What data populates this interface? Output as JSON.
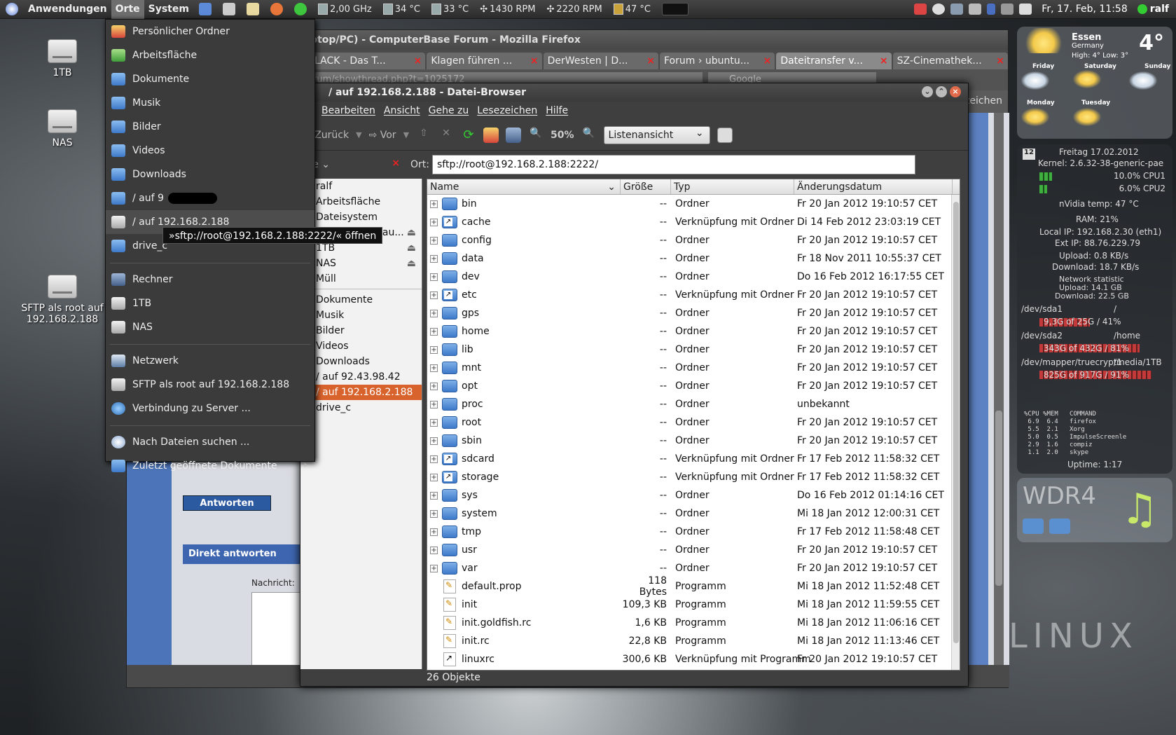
{
  "panel": {
    "menus": [
      "Anwendungen",
      "Orte",
      "System"
    ],
    "sensors": {
      "cpu_freq": "2,00 GHz",
      "temp1": "34 °C",
      "temp2": "33 °C",
      "fan1": "1430 RPM",
      "fan2": "2220 RPM",
      "temp3": "47 °C"
    },
    "clock": "Fr, 17. Feb, 11:58",
    "user": "ralf"
  },
  "desktop_icons": [
    {
      "label": "1TB"
    },
    {
      "label": "NAS"
    },
    {
      "label": "SFTP als root auf 192.168.2.188"
    }
  ],
  "places_menu": {
    "items": [
      {
        "label": "Persönlicher Ordner",
        "icon": "home-icon"
      },
      {
        "label": "Arbeitsfläche",
        "icon": "desktop-icon"
      },
      {
        "label": "Dokumente",
        "icon": "folder-icon"
      },
      {
        "label": "Musik",
        "icon": "folder-icon"
      },
      {
        "label": "Bilder",
        "icon": "folder-icon"
      },
      {
        "label": "Videos",
        "icon": "folder-icon"
      },
      {
        "label": "Downloads",
        "icon": "folder-icon"
      },
      {
        "label": "/ auf 9",
        "icon": "folder-icon"
      },
      {
        "label": "/ auf 192.168.2.188",
        "icon": "drive-icon"
      },
      {
        "label": "drive_c",
        "icon": "folder-icon"
      }
    ],
    "devices": [
      {
        "label": "Rechner",
        "icon": "computer-icon"
      },
      {
        "label": "1TB",
        "icon": "drive-icon"
      },
      {
        "label": "NAS",
        "icon": "drive-icon"
      }
    ],
    "network": [
      {
        "label": "Netzwerk",
        "icon": "network-icon"
      },
      {
        "label": "SFTP als root auf 192.168.2.188",
        "icon": "drive-icon"
      },
      {
        "label": "Verbindung zu Server ...",
        "icon": "globe-icon"
      }
    ],
    "extras": [
      {
        "label": "Nach Dateien suchen ...",
        "icon": "search-icon"
      },
      {
        "label": "Zuletzt geöffnete Dokumente",
        "icon": "folder-icon"
      }
    ],
    "tooltip": "»sftp://root@192.168.2.188:2222/« öffnen"
  },
  "firefox": {
    "title": "ptop/PC) - ComputerBase Forum - Mozilla Firefox",
    "tabs": [
      {
        "label": "LACK - Das T..."
      },
      {
        "label": "Klagen führen ..."
      },
      {
        "label": "DerWesten | D..."
      },
      {
        "label": "Forum › ubuntu..."
      },
      {
        "label": "Dateitransfer v...",
        "active": true
      },
      {
        "label": "SZ-Cinemathek..."
      }
    ],
    "url": "rum/showthread.php?t=1025172",
    "search_placeholder": "Google",
    "bookmarks_label": "ezeichen",
    "antworten": "Antworten",
    "direkt_antworten": "Direkt antworten",
    "nachricht": "Nachricht:"
  },
  "filebrowser": {
    "title": "/ auf 192.168.2.188 - Datei-Browser",
    "menu": [
      "tei",
      "Bearbeiten",
      "Ansicht",
      "Gehe zu",
      "Lesezeichen",
      "Hilfe"
    ],
    "toolbar": {
      "back": "Zurück",
      "forward": "Vor",
      "zoom": "50%",
      "view": "Listenansicht"
    },
    "side_title": "rte",
    "location_label": "Ort:",
    "location": "sftp://root@192.168.2.188:2222/",
    "sidebar": [
      {
        "label": "ralf"
      },
      {
        "label": "Arbeitsfläche"
      },
      {
        "label": "Dateisystem"
      },
      {
        "label": "SFTP als root au...",
        "eject": true
      },
      {
        "label": "1TB",
        "eject": true
      },
      {
        "label": "NAS",
        "eject": true
      },
      {
        "label": "Müll"
      },
      {
        "label": "Dokumente",
        "sep": true
      },
      {
        "label": "Musik"
      },
      {
        "label": "Bilder"
      },
      {
        "label": "Videos"
      },
      {
        "label": "Downloads"
      },
      {
        "label": "/ auf 92.43.98.42"
      },
      {
        "label": "/ auf 192.168.2.188",
        "selected": true
      },
      {
        "label": "drive_c"
      }
    ],
    "columns": [
      "Name",
      "Größe",
      "Typ",
      "Änderungsdatum"
    ],
    "rows": [
      {
        "name": "bin",
        "size": "--",
        "type": "Ordner",
        "date": "Fr 20 Jan 2012 19:10:57 CET",
        "kind": "folder"
      },
      {
        "name": "cache",
        "size": "--",
        "type": "Verknüpfung mit Ordner",
        "date": "Di 14 Feb 2012 23:03:19 CET",
        "kind": "folderlink"
      },
      {
        "name": "config",
        "size": "--",
        "type": "Ordner",
        "date": "Fr 20 Jan 2012 19:10:57 CET",
        "kind": "folder"
      },
      {
        "name": "data",
        "size": "--",
        "type": "Ordner",
        "date": "Fr 18 Nov 2011 10:55:37 CET",
        "kind": "folder"
      },
      {
        "name": "dev",
        "size": "--",
        "type": "Ordner",
        "date": "Do 16 Feb 2012 16:17:55 CET",
        "kind": "folder"
      },
      {
        "name": "etc",
        "size": "--",
        "type": "Verknüpfung mit Ordner",
        "date": "Fr 20 Jan 2012 19:10:57 CET",
        "kind": "folderlink"
      },
      {
        "name": "gps",
        "size": "--",
        "type": "Ordner",
        "date": "Fr 20 Jan 2012 19:10:57 CET",
        "kind": "folder"
      },
      {
        "name": "home",
        "size": "--",
        "type": "Ordner",
        "date": "Fr 20 Jan 2012 19:10:57 CET",
        "kind": "folder"
      },
      {
        "name": "lib",
        "size": "--",
        "type": "Ordner",
        "date": "Fr 20 Jan 2012 19:10:57 CET",
        "kind": "folder"
      },
      {
        "name": "mnt",
        "size": "--",
        "type": "Ordner",
        "date": "Fr 20 Jan 2012 19:10:57 CET",
        "kind": "folder"
      },
      {
        "name": "opt",
        "size": "--",
        "type": "Ordner",
        "date": "Fr 20 Jan 2012 19:10:57 CET",
        "kind": "folder"
      },
      {
        "name": "proc",
        "size": "--",
        "type": "Ordner",
        "date": "unbekannt",
        "kind": "folder"
      },
      {
        "name": "root",
        "size": "--",
        "type": "Ordner",
        "date": "Fr 20 Jan 2012 19:10:57 CET",
        "kind": "folder"
      },
      {
        "name": "sbin",
        "size": "--",
        "type": "Ordner",
        "date": "Fr 20 Jan 2012 19:10:57 CET",
        "kind": "folder"
      },
      {
        "name": "sdcard",
        "size": "--",
        "type": "Verknüpfung mit Ordner",
        "date": "Fr 17 Feb 2012 11:58:32 CET",
        "kind": "folderlink"
      },
      {
        "name": "storage",
        "size": "--",
        "type": "Verknüpfung mit Ordner",
        "date": "Fr 17 Feb 2012 11:58:32 CET",
        "kind": "folderlink"
      },
      {
        "name": "sys",
        "size": "--",
        "type": "Ordner",
        "date": "Do 16 Feb 2012 01:14:16 CET",
        "kind": "folder"
      },
      {
        "name": "system",
        "size": "--",
        "type": "Ordner",
        "date": "Mi 18 Jan 2012 12:00:31 CET",
        "kind": "folder"
      },
      {
        "name": "tmp",
        "size": "--",
        "type": "Ordner",
        "date": "Fr 17 Feb 2012 11:58:48 CET",
        "kind": "folder"
      },
      {
        "name": "usr",
        "size": "--",
        "type": "Ordner",
        "date": "Fr 20 Jan 2012 19:10:57 CET",
        "kind": "folder"
      },
      {
        "name": "var",
        "size": "--",
        "type": "Ordner",
        "date": "Fr 20 Jan 2012 19:10:57 CET",
        "kind": "folder"
      },
      {
        "name": "default.prop",
        "size": "118 Bytes",
        "type": "Programm",
        "date": "Mi 18 Jan 2012 11:52:48 CET",
        "kind": "file"
      },
      {
        "name": "init",
        "size": "109,3 KB",
        "type": "Programm",
        "date": "Mi 18 Jan 2012 11:59:55 CET",
        "kind": "file"
      },
      {
        "name": "init.goldfish.rc",
        "size": "1,6 KB",
        "type": "Programm",
        "date": "Mi 18 Jan 2012 11:06:16 CET",
        "kind": "file"
      },
      {
        "name": "init.rc",
        "size": "22,8 KB",
        "type": "Programm",
        "date": "Mi 18 Jan 2012 11:13:46 CET",
        "kind": "file"
      },
      {
        "name": "linuxrc",
        "size": "300,6 KB",
        "type": "Verknüpfung mit Programm",
        "date": "Fr 20 Jan 2012 19:10:57 CET",
        "kind": "filelink"
      }
    ],
    "status": "26 Objekte"
  },
  "weather": {
    "city": "Essen",
    "country": "Germany",
    "high_low": "High: 4°   Low: 3°",
    "temp": "4°",
    "days": [
      "Friday",
      "Saturday",
      "Sunday",
      "Monday",
      "Tuesday"
    ]
  },
  "conky": {
    "date": "Freitag 17.02.2012",
    "kernel": "Kernel: 2.6.32-38-generic-pae",
    "cpu1": "10.0% CPU1",
    "cpu1_level": 0.1,
    "cpu2": "6.0% CPU2",
    "cpu2_level": 0.06,
    "nvidia": "nVidia temp: 47 °C",
    "ram": "RAM: 21%",
    "local_ip": "Local IP: 192.168.2.30 (eth1)",
    "ext_ip": "Ext IP: 88.76.229.79",
    "upload": "Upload: 0.8 KB/s",
    "download": "Download: 18.7 KB/s",
    "netstat_title": "Network statistic",
    "net_up": "Upload: 14.1 GB",
    "net_down": "Download: 22.5 GB",
    "disks": [
      {
        "dev": "/dev/sda1",
        "mount": "/",
        "usage": "9,3G of 25G / 41%",
        "level": 0.41
      },
      {
        "dev": "/dev/sda2",
        "mount": "/home",
        "usage": "343G of 432G / 81%",
        "level": 0.81
      },
      {
        "dev": "/dev/mapper/truecrypt1",
        "mount": "/media/1TB",
        "usage": "825G of 917G / 91%",
        "level": 0.91
      }
    ],
    "procs": "%CPU %MEM   COMMAND\n 6.9  6.4   firefox\n 5.5  2.1   Xorg\n 5.0  0.5   ImpulseScreenle\n 2.9  1.6   compiz\n 1.1  2.0   skype",
    "uptime": "Uptime: 1:17",
    "calendar_day": "12"
  },
  "radio": {
    "station": "WDR4"
  }
}
